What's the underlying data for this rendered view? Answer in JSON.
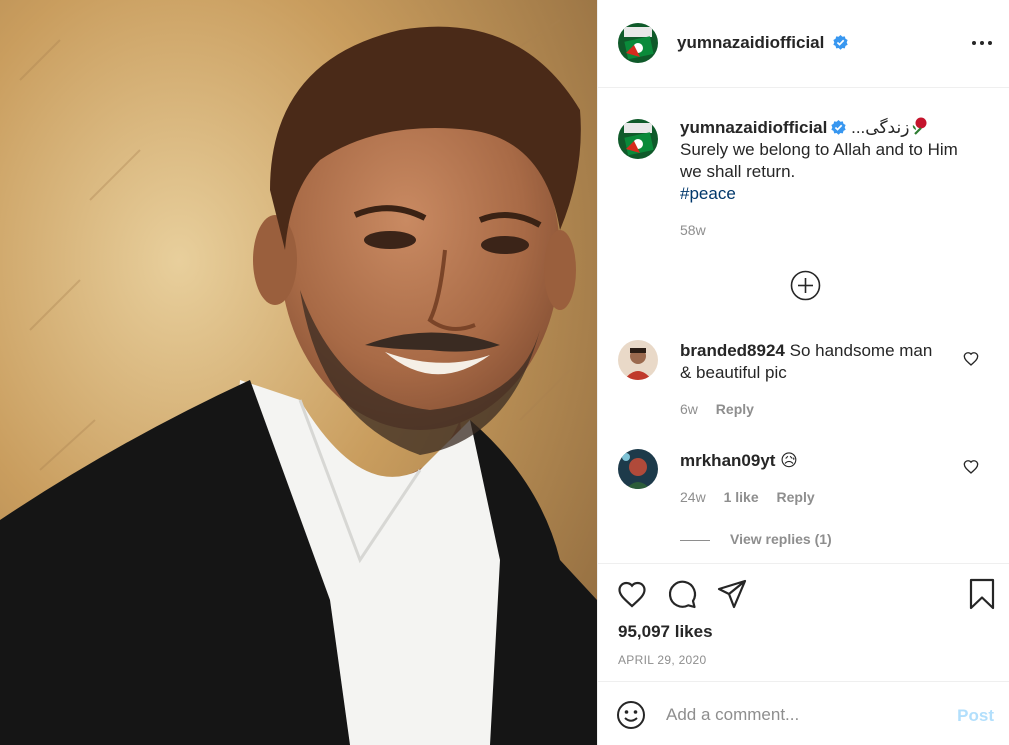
{
  "post": {
    "username": "yumnazaidiofficial",
    "caption_urdu": "زندگی...",
    "caption_text": "Surely we belong to Allah and to Him we shall return.",
    "caption_line1": "Surely we belong to Allah and to Him",
    "caption_line2": "we shall return.",
    "hashtag": "#peace",
    "caption_age": "58w",
    "likes": "95,097 likes",
    "date": "APRIL 29, 2020"
  },
  "comments": [
    {
      "username": "branded8924",
      "text_line1": "So handsome man",
      "text_line2": "& beautiful pic",
      "age": "6w",
      "reply_label": "Reply"
    },
    {
      "username": "mrkhan09yt",
      "text": "😥",
      "age": "24w",
      "likes": "1 like",
      "reply_label": "Reply",
      "view_replies": "View replies (1)"
    }
  ],
  "composer": {
    "placeholder": "Add a comment...",
    "post_label": "Post"
  },
  "colors": {
    "verified": "#3897f0",
    "hashtag": "#00376b",
    "muted": "#8e8e8e",
    "post_disabled": "#b2dffc"
  },
  "icons": [
    "more-options-icon",
    "verified-badge-icon",
    "load-more-plus-icon",
    "heart-icon",
    "comment-icon",
    "share-icon",
    "bookmark-icon",
    "emoji-icon"
  ]
}
